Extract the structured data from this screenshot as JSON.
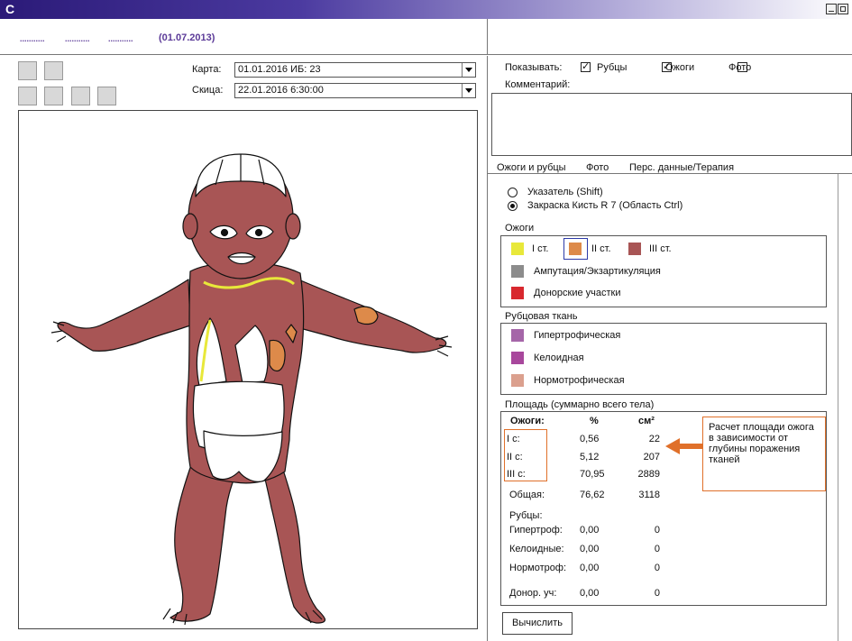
{
  "app": {
    "title": "C"
  },
  "header": {
    "dots": [
      "...........",
      "...........",
      "..........."
    ],
    "date": "(01.07.2013)"
  },
  "left": {
    "karta_label": "Карта:",
    "karta_value": "01.01.2016 ИБ: 23",
    "skitsa_label": "Скица:",
    "skitsa_value": "22.01.2016 6:30:00"
  },
  "show": {
    "label": "Показывать:",
    "scars_label": "Рубцы",
    "scars_checked": true,
    "burns_label": "Ожоги",
    "burns_checked": true,
    "photo_label": "Фото",
    "photo_checked": false
  },
  "comment": {
    "label": "Комментарий:"
  },
  "tabs": [
    "Ожоги и рубцы",
    "Фото",
    "Перс. данные/Терапия"
  ],
  "tools": {
    "pointer_label": "Указатель (Shift)",
    "paint_label": "Закраска Кисть R 7 (Область Ctrl)",
    "selected": "paint"
  },
  "burns": {
    "title": "Ожоги",
    "deg1": "I ст.",
    "deg2": "II ст.",
    "deg3": "III ст.",
    "amputation": "Ампутация/Экзартикуляция",
    "donor": "Донорские участки",
    "colors": {
      "deg1": "#e8e83a",
      "deg2": "#dd8a4a",
      "deg3": "#a85555",
      "amputation": "#8c8c8c",
      "donor": "#d8282e"
    }
  },
  "scars": {
    "title": "Рубцовая ткань",
    "hypertrophic": "Гипертрофическая",
    "keloid": "Келоидная",
    "normotrophic": "Нормотрофическая",
    "colors": {
      "hypertrophic": "#a566a8",
      "keloid": "#a8479c",
      "normotrophic": "#dba08e"
    }
  },
  "area": {
    "title": "Площадь (суммарно всего тела)",
    "head_burns": "Ожоги:",
    "head_pct": "%",
    "head_cm": "см²",
    "rows": [
      {
        "label": "I с:",
        "pct": "0,56",
        "cm": "22"
      },
      {
        "label": "II с:",
        "pct": "5,12",
        "cm": "207"
      },
      {
        "label": "III с:",
        "pct": "70,95",
        "cm": "2889"
      },
      {
        "label": "Общая:",
        "pct": "76,62",
        "cm": "3118"
      }
    ],
    "scars_head": "Рубцы:",
    "scar_rows": [
      {
        "label": "Гипертроф:",
        "pct": "0,00",
        "cm": "0"
      },
      {
        "label": "Келоидные:",
        "pct": "0,00",
        "cm": "0"
      },
      {
        "label": "Нормотроф:",
        "pct": "0,00",
        "cm": "0"
      }
    ],
    "donor_row": {
      "label": "Донор. уч:",
      "pct": "0,00",
      "cm": "0"
    }
  },
  "callout": "Расчет площади ожога в зависимости от глубины поражения тканей",
  "calc_button": "Вычислить"
}
